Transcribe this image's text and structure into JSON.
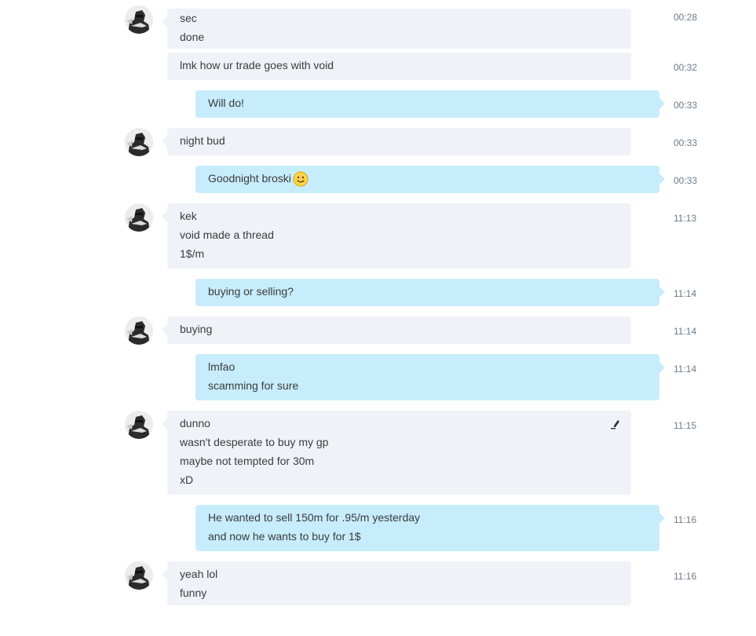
{
  "messages": [
    {
      "dir": "in",
      "avatar": true,
      "time": "00:28",
      "lines": [
        "sec",
        "done"
      ]
    },
    {
      "dir": "in",
      "avatar": false,
      "time": "00:32",
      "lines": [
        "lmk how ur trade goes with void"
      ]
    },
    {
      "dir": "out",
      "time": "00:33",
      "lines": [
        "Will do!"
      ]
    },
    {
      "dir": "in",
      "avatar": true,
      "time": "00:33",
      "lines": [
        "night bud"
      ]
    },
    {
      "dir": "out",
      "time": "00:33",
      "lines": [
        "Goodnight broski"
      ],
      "emoji": "smile-emoji-icon"
    },
    {
      "dir": "in",
      "avatar": true,
      "time": "11:13",
      "lines": [
        "kek",
        "void made a thread",
        "1$/m"
      ]
    },
    {
      "dir": "out",
      "time": "11:14",
      "lines": [
        "buying or selling?"
      ]
    },
    {
      "dir": "in",
      "avatar": true,
      "time": "11:14",
      "lines": [
        "buying"
      ]
    },
    {
      "dir": "out",
      "time": "11:14",
      "lines": [
        "lmfao",
        "scamming for sure"
      ]
    },
    {
      "dir": "in",
      "avatar": true,
      "time": "11:15",
      "lines": [
        "dunno",
        "wasn't desperate to buy my gp",
        "maybe not tempted for 30m",
        "xD"
      ],
      "edited": true
    },
    {
      "dir": "out",
      "time": "11:16",
      "lines": [
        "He wanted to sell 150m for .95/m yesterday",
        "and now he wants to buy for 1$"
      ]
    },
    {
      "dir": "in",
      "avatar": true,
      "time": "11:16",
      "lines": [
        "yeah lol",
        "funny"
      ]
    }
  ],
  "colors": {
    "incoming_bubble": "#eff2f7",
    "outgoing_bubble": "#c7ecfc",
    "timestamp": "#6b7a8a",
    "text": "#3b3b3b"
  }
}
